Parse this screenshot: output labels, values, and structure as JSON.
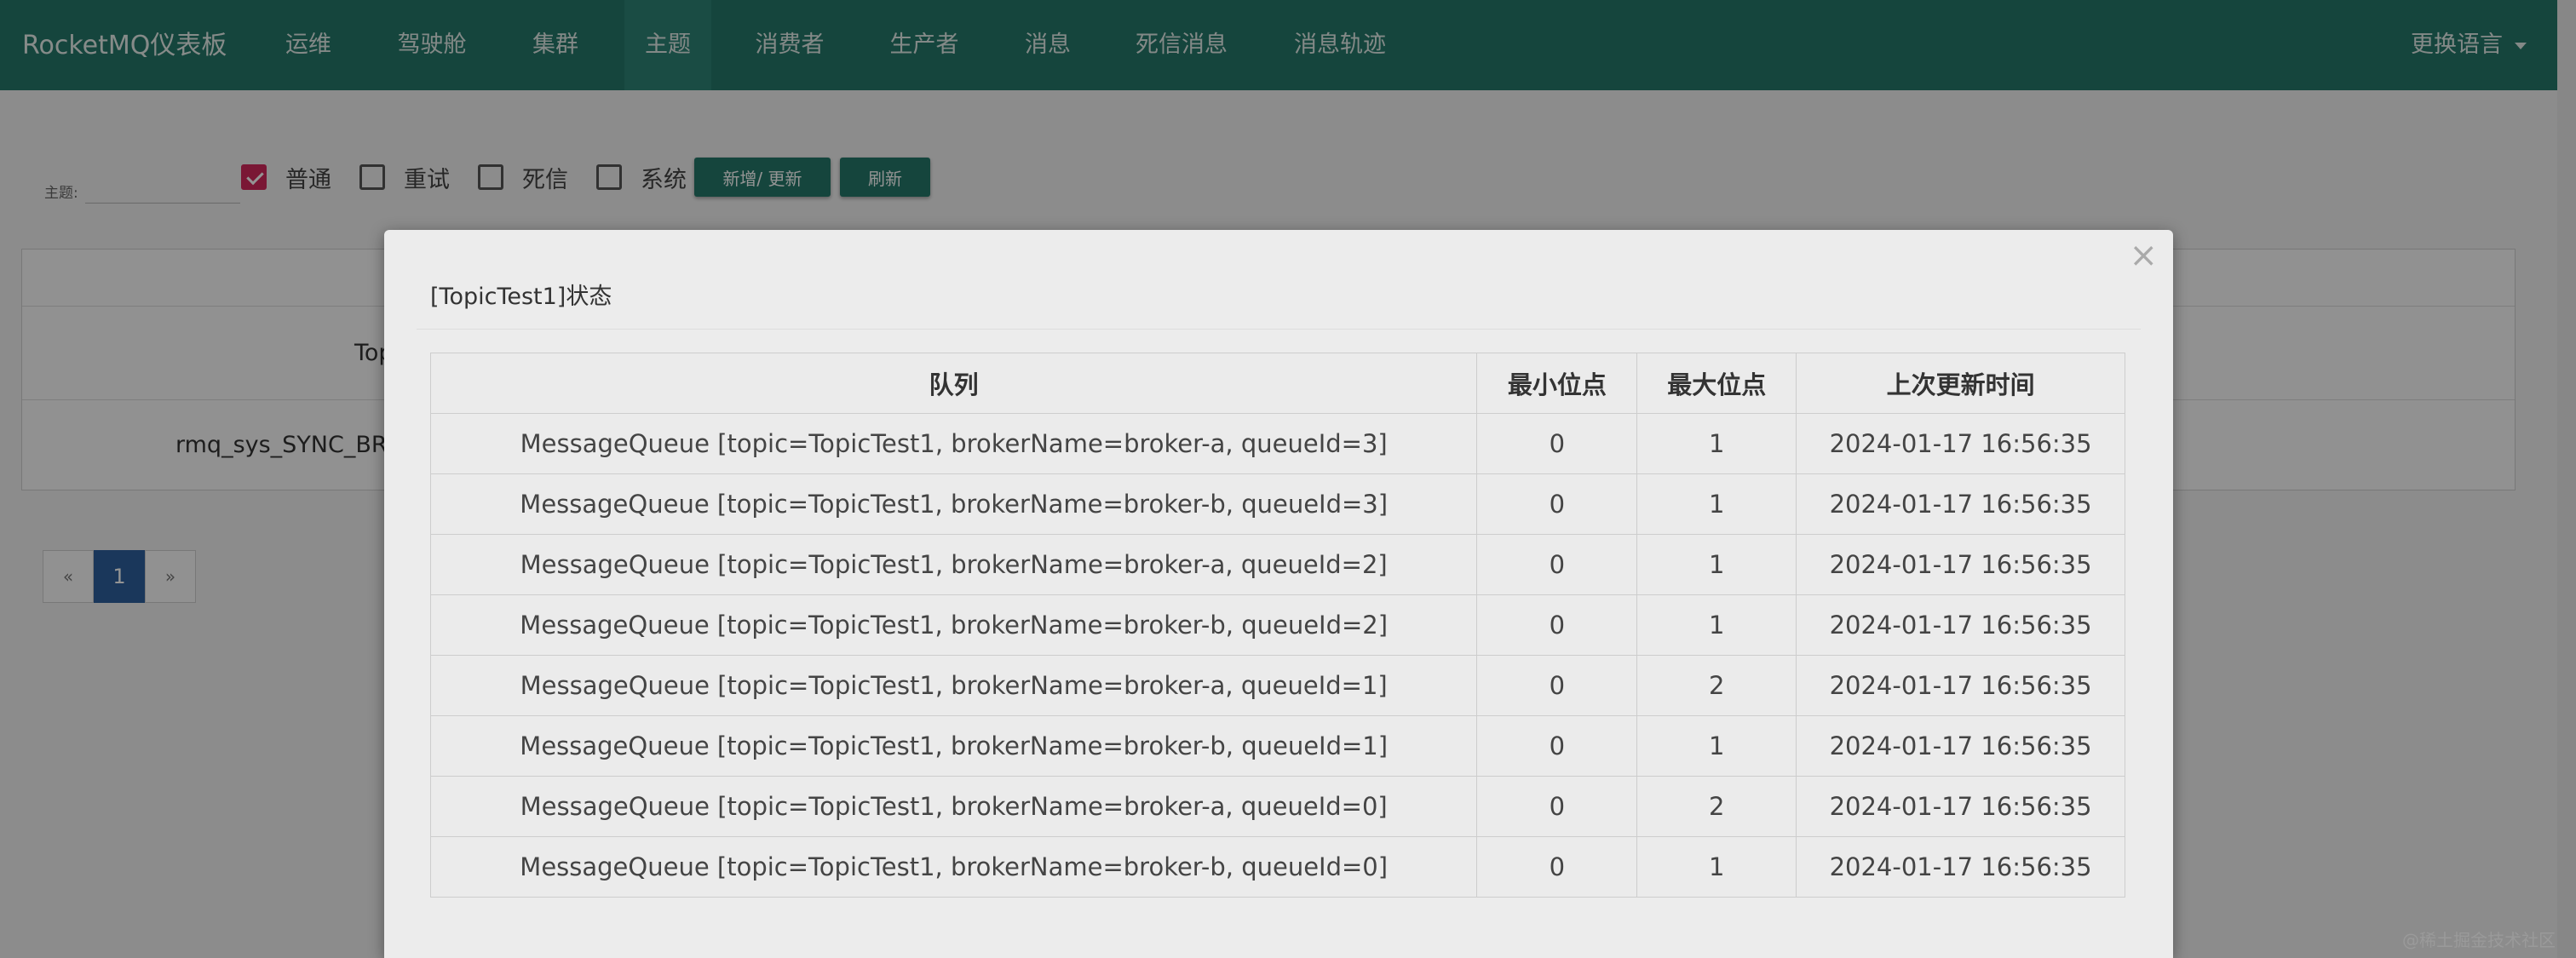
{
  "navbar": {
    "brand": "RocketMQ仪表板",
    "items": [
      "运维",
      "驾驶舱",
      "集群",
      "主题",
      "消费者",
      "生产者",
      "消息",
      "死信消息",
      "消息轨迹"
    ],
    "active_item": "主题",
    "language": "更换语言"
  },
  "filter": {
    "topic_label": "主题:",
    "topic_value": "",
    "checkboxes": [
      {
        "label": "普通",
        "checked": true
      },
      {
        "label": "重试",
        "checked": false
      },
      {
        "label": "死信",
        "checked": false
      },
      {
        "label": "系统",
        "checked": false
      }
    ],
    "add_update_button": "新增/ 更新",
    "refresh_button": "刷新"
  },
  "background_table": {
    "row1_partial": "Top",
    "row2_partial": "rmq_sys_SYNC_BRO"
  },
  "pagination": {
    "prev": "«",
    "current": "1",
    "next": "»"
  },
  "modal": {
    "title": "[TopicTest1]状态",
    "close": "×",
    "columns": [
      "队列",
      "最小位点",
      "最大位点",
      "上次更新时间"
    ],
    "rows": [
      {
        "queue": "MessageQueue [topic=TopicTest1, brokerName=broker-a, queueId=3]",
        "min": "0",
        "max": "1",
        "time": "2024-01-17 16:56:35"
      },
      {
        "queue": "MessageQueue [topic=TopicTest1, brokerName=broker-b, queueId=3]",
        "min": "0",
        "max": "1",
        "time": "2024-01-17 16:56:35"
      },
      {
        "queue": "MessageQueue [topic=TopicTest1, brokerName=broker-a, queueId=2]",
        "min": "0",
        "max": "1",
        "time": "2024-01-17 16:56:35"
      },
      {
        "queue": "MessageQueue [topic=TopicTest1, brokerName=broker-b, queueId=2]",
        "min": "0",
        "max": "1",
        "time": "2024-01-17 16:56:35"
      },
      {
        "queue": "MessageQueue [topic=TopicTest1, brokerName=broker-a, queueId=1]",
        "min": "0",
        "max": "2",
        "time": "2024-01-17 16:56:35"
      },
      {
        "queue": "MessageQueue [topic=TopicTest1, brokerName=broker-b, queueId=1]",
        "min": "0",
        "max": "1",
        "time": "2024-01-17 16:56:35"
      },
      {
        "queue": "MessageQueue [topic=TopicTest1, brokerName=broker-a, queueId=0]",
        "min": "0",
        "max": "2",
        "time": "2024-01-17 16:56:35"
      },
      {
        "queue": "MessageQueue [topic=TopicTest1, brokerName=broker-b, queueId=0]",
        "min": "0",
        "max": "1",
        "time": "2024-01-17 16:56:35"
      }
    ]
  },
  "watermark": "@稀土掘金技术社区",
  "colors": {
    "navbar": "#25786a",
    "checkbox_checked": "#d3285c",
    "page_active": "#2d5f9e"
  }
}
